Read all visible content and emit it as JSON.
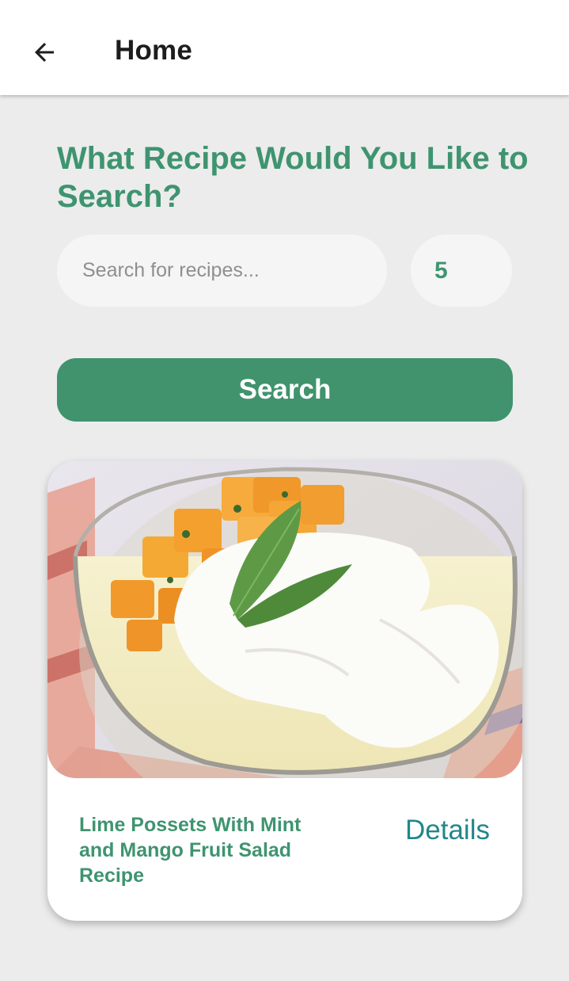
{
  "appbar": {
    "title": "Home",
    "back_icon": "arrow-left-icon"
  },
  "heading": "What Recipe Would You Like to Search?",
  "search": {
    "placeholder": "Search for recipes...",
    "value": "",
    "count": "5",
    "button_label": "Search"
  },
  "results": [
    {
      "title": "Lime Possets With Mint and Mango Fruit Salad Recipe",
      "details_label": "Details"
    }
  ],
  "colors": {
    "accent": "#40936d",
    "link": "#23868a",
    "background": "#ececec"
  }
}
